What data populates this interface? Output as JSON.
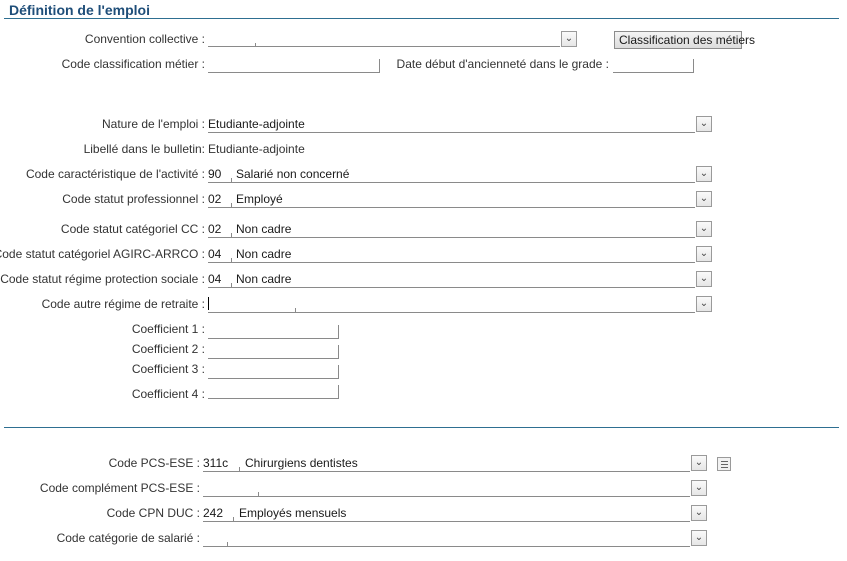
{
  "section": {
    "title": "Définition de l'emploi"
  },
  "convention": {
    "label": "Convention collective :",
    "value": ""
  },
  "classification_button": "Classification des métiers",
  "code_classification": {
    "label": "Code classification métier :",
    "value": ""
  },
  "date_anciennete": {
    "label": "Date début d'ancienneté dans le grade :",
    "value": ""
  },
  "nature": {
    "label": "Nature de l'emploi :",
    "value": "Etudiante-adjointe"
  },
  "libelle": {
    "label": "Libellé dans le bulletin:",
    "value": "Etudiante-adjointe"
  },
  "caracteristique": {
    "label": "Code caractéristique de l'activité :",
    "code": "90",
    "text": "Salarié non concerné"
  },
  "statut_pro": {
    "label": "Code statut professionnel :",
    "code": "02",
    "text": "Employé"
  },
  "statut_cc": {
    "label": "Code statut catégoriel CC :",
    "code": "02",
    "text": "Non cadre"
  },
  "statut_agirc": {
    "label": "Code statut catégoriel AGIRC-ARRCO :",
    "code": "04",
    "text": "Non cadre"
  },
  "statut_regime": {
    "label": "Code statut régime protection sociale :",
    "code": "04",
    "text": "Non cadre"
  },
  "autre_regime": {
    "label": "Code autre régime de retraite :",
    "code": "",
    "text": ""
  },
  "coefficients": [
    {
      "label": "Coefficient 1 :",
      "value": ""
    },
    {
      "label": "Coefficient 2 :",
      "value": ""
    },
    {
      "label": "Coefficient 3 :",
      "value": ""
    },
    {
      "label": "Coefficient 4 :",
      "value": ""
    }
  ],
  "pcs_ese": {
    "label": "Code PCS-ESE :",
    "code": "311c",
    "text": "Chirurgiens dentistes"
  },
  "complement_pcs": {
    "label": "Code complément PCS-ESE :",
    "code": "",
    "text": ""
  },
  "cpn_duc": {
    "label": "Code CPN DUC :",
    "code": "242",
    "text": "Employés mensuels"
  },
  "categorie_salarie": {
    "label": "Code catégorie de salarié :",
    "code": "",
    "text": ""
  }
}
